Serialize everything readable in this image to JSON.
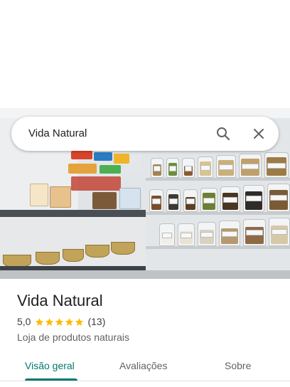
{
  "search": {
    "query": "Vida Natural"
  },
  "icons": {
    "search": "search-icon",
    "close": "close-icon",
    "star": "star-icon"
  },
  "place": {
    "name": "Vida Natural",
    "rating": "5,0",
    "stars_filled": 5,
    "stars_total": 5,
    "review_count": "(13)",
    "category": "Loja de produtos naturais"
  },
  "tabs": [
    {
      "label": "Visão geral",
      "selected": true
    },
    {
      "label": "Avaliações",
      "selected": false
    },
    {
      "label": "Sobre",
      "selected": false
    }
  ],
  "colors": {
    "accent": "#00796b",
    "star": "#fbbc04",
    "text_primary": "#202124",
    "text_secondary": "#5f6368"
  }
}
